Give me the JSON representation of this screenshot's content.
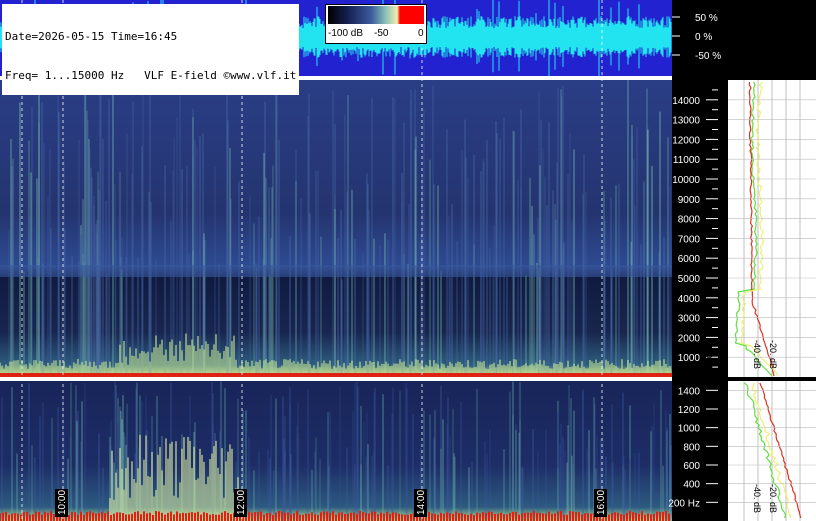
{
  "info": {
    "line1": "Date=2026-05-15 Time=16:45",
    "line2": "Freq= 1...15000 Hz   VLF E-field ©www.vlf.it"
  },
  "color_scale": {
    "labels": [
      "-100 dB",
      "-50",
      "0"
    ],
    "colors": [
      "#000000",
      "#1a2a6b",
      "#6fa0c0",
      "#e8f0b0",
      "#ff0000"
    ]
  },
  "colors": {
    "waveform": "#22e4f0",
    "waveform_bg": "#2222d0",
    "spectrum_bg": "#1c2a66",
    "profile_max": "#e03020",
    "profile_avg": "#f0f070",
    "profile_min": "#60e040",
    "grid": "#ffffff"
  },
  "chart_data": [
    {
      "type": "line",
      "panel": "waveform",
      "title": "",
      "ylabel": "",
      "y_tick_labels": [
        "50 %",
        "0 %",
        "-50 %"
      ],
      "ylim": [
        -100,
        100
      ]
    },
    {
      "type": "heatmap",
      "panel": "spectrogram-full",
      "x_tick_labels": [
        "10:00",
        "12:00",
        "14:00",
        "16:00"
      ],
      "y_tick_labels": [
        "14000",
        "13000",
        "12000",
        "11000",
        "10000",
        "9000",
        "8000",
        "7000",
        "6000",
        "5000",
        "4000",
        "3000",
        "2000",
        "1000"
      ],
      "ylim": [
        0,
        15000
      ],
      "yunit": "Hz"
    },
    {
      "type": "heatmap",
      "panel": "spectrogram-low",
      "x_tick_labels": [
        "10:00",
        "12:00",
        "14:00",
        "16:00"
      ],
      "y_tick_labels": [
        "1400",
        "1200",
        "1000",
        "800",
        "600",
        "400",
        "200 Hz"
      ],
      "ylim": [
        0,
        1500
      ]
    },
    {
      "type": "line",
      "panel": "spectrum-profile",
      "x_tick_labels": [
        "-100. dB",
        "-40. dB",
        "-20. dB"
      ],
      "series": []
    }
  ]
}
